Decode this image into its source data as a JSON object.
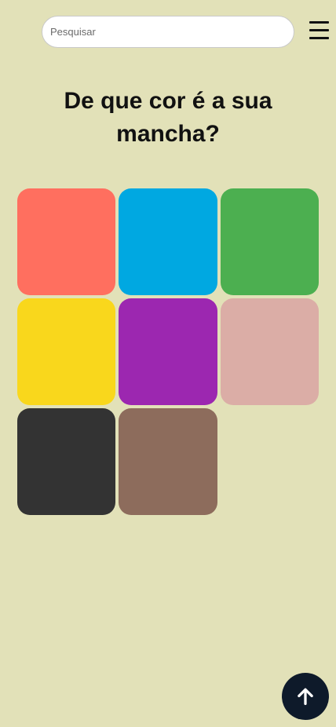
{
  "search": {
    "placeholder": "Pesquisar"
  },
  "header": {
    "menu_icon": "hamburger-menu-icon"
  },
  "page": {
    "title": "De que cor é a sua mancha?"
  },
  "swatches": [
    {
      "name": "coral",
      "color": "#ff6f5f"
    },
    {
      "name": "blue",
      "color": "#00a8e1"
    },
    {
      "name": "green",
      "color": "#4caf50"
    },
    {
      "name": "yellow",
      "color": "#f9d71c"
    },
    {
      "name": "purple",
      "color": "#9c27b0"
    },
    {
      "name": "pink",
      "color": "#dbada6"
    },
    {
      "name": "dark-gray",
      "color": "#333333"
    },
    {
      "name": "brown",
      "color": "#8d6c5c"
    }
  ],
  "scroll_top": {
    "icon": "arrow-up-icon",
    "color": "#0e1a2a"
  },
  "colors": {
    "background": "#e2e1b8"
  }
}
